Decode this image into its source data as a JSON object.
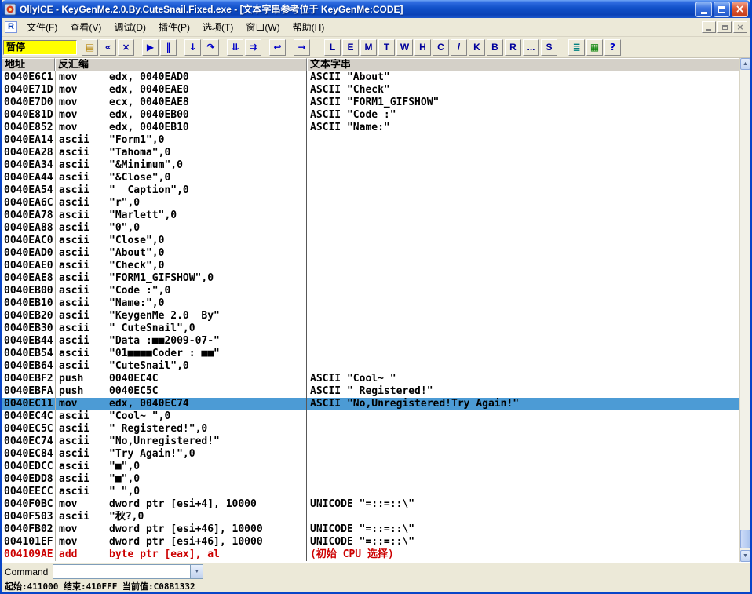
{
  "window": {
    "title": "OllyICE - KeyGenMe.2.0.By.CuteSnail.Fixed.exe - [文本字串参考位于 KeyGenMe:CODE]"
  },
  "mdi": {
    "icon_letter": "R"
  },
  "menu": {
    "items": [
      {
        "label": "文件(F)",
        "name": "menu-file"
      },
      {
        "label": "查看(V)",
        "name": "menu-view"
      },
      {
        "label": "调试(D)",
        "name": "menu-debug"
      },
      {
        "label": "插件(P)",
        "name": "menu-plugins"
      },
      {
        "label": "选项(T)",
        "name": "menu-options"
      },
      {
        "label": "窗口(W)",
        "name": "menu-window"
      },
      {
        "label": "帮助(H)",
        "name": "menu-help"
      }
    ]
  },
  "toolbar": {
    "status": "暂停",
    "buttons": [
      {
        "name": "open-button",
        "glyph": "▤",
        "color": "#B8860B"
      },
      {
        "name": "restart-button",
        "glyph": "«",
        "color": "#0000A8"
      },
      {
        "name": "close-program-button",
        "glyph": "×",
        "color": "#0000A8"
      },
      {
        "sep": true
      },
      {
        "name": "run-button",
        "glyph": "▶",
        "color": "#0000C8"
      },
      {
        "name": "pause-button",
        "glyph": "‖",
        "color": "#0000C8"
      },
      {
        "sep": true
      },
      {
        "name": "step-into-button",
        "glyph": "↓",
        "color": "#0000C8"
      },
      {
        "name": "step-over-button",
        "glyph": "↷",
        "color": "#0000C8"
      },
      {
        "sep": true
      },
      {
        "name": "trace-into-button",
        "glyph": "⇊",
        "color": "#0000C8"
      },
      {
        "name": "trace-over-button",
        "glyph": "⇉",
        "color": "#0000C8"
      },
      {
        "sep": true
      },
      {
        "name": "execute-till-return-button",
        "glyph": "↩",
        "color": "#0000C8"
      },
      {
        "sep": true
      },
      {
        "name": "goto-address-button",
        "glyph": "→",
        "color": "#0000C8"
      }
    ],
    "letters": [
      {
        "label": "L",
        "name": "log-window-button"
      },
      {
        "label": "E",
        "name": "executables-button"
      },
      {
        "label": "M",
        "name": "memory-map-button"
      },
      {
        "label": "T",
        "name": "threads-button"
      },
      {
        "label": "W",
        "name": "windows-button"
      },
      {
        "label": "H",
        "name": "handles-button"
      },
      {
        "label": "C",
        "name": "cpu-button"
      },
      {
        "label": "/",
        "name": "patches-button"
      },
      {
        "label": "K",
        "name": "call-stack-button"
      },
      {
        "label": "B",
        "name": "breakpoints-button"
      },
      {
        "label": "R",
        "name": "references-button"
      },
      {
        "label": "...",
        "name": "run-trace-button"
      },
      {
        "label": "S",
        "name": "source-button"
      }
    ],
    "right_buttons": [
      {
        "label": "≣",
        "name": "options-button",
        "color": "#008080"
      },
      {
        "label": "▦",
        "name": "appearance-button",
        "color": "#008000"
      },
      {
        "label": "?",
        "name": "help-button",
        "color": "#0000C8"
      }
    ]
  },
  "panel": {
    "headers": {
      "address": "地址",
      "disasm": "反汇编",
      "text": "文本字串"
    }
  },
  "rows": [
    {
      "addr": "0040E6C1",
      "mn": "mov",
      "ops": "edx, 0040EAD0",
      "cmt": "ASCII \"About\""
    },
    {
      "addr": "0040E71D",
      "mn": "mov",
      "ops": "edx, 0040EAE0",
      "cmt": "ASCII \"Check\""
    },
    {
      "addr": "0040E7D0",
      "mn": "mov",
      "ops": "ecx, 0040EAE8",
      "cmt": "ASCII \"FORM1_GIFSHOW\""
    },
    {
      "addr": "0040E81D",
      "mn": "mov",
      "ops": "edx, 0040EB00",
      "cmt": "ASCII \"Code :\""
    },
    {
      "addr": "0040E852",
      "mn": "mov",
      "ops": "edx, 0040EB10",
      "cmt": "ASCII \"Name:\""
    },
    {
      "addr": "0040EA14",
      "mn": "ascii",
      "ops": "\"Form1\",0",
      "cmt": ""
    },
    {
      "addr": "0040EA28",
      "mn": "ascii",
      "ops": "\"Tahoma\",0",
      "cmt": ""
    },
    {
      "addr": "0040EA34",
      "mn": "ascii",
      "ops": "\"&Minimum\",0",
      "cmt": ""
    },
    {
      "addr": "0040EA44",
      "mn": "ascii",
      "ops": "\"&Close\",0",
      "cmt": ""
    },
    {
      "addr": "0040EA54",
      "mn": "ascii",
      "ops": "\"  Caption\",0",
      "cmt": ""
    },
    {
      "addr": "0040EA6C",
      "mn": "ascii",
      "ops": "\"r\",0",
      "cmt": ""
    },
    {
      "addr": "0040EA78",
      "mn": "ascii",
      "ops": "\"Marlett\",0",
      "cmt": ""
    },
    {
      "addr": "0040EA88",
      "mn": "ascii",
      "ops": "\"0\",0",
      "cmt": ""
    },
    {
      "addr": "0040EAC0",
      "mn": "ascii",
      "ops": "\"Close\",0",
      "cmt": ""
    },
    {
      "addr": "0040EAD0",
      "mn": "ascii",
      "ops": "\"About\",0",
      "cmt": ""
    },
    {
      "addr": "0040EAE0",
      "mn": "ascii",
      "ops": "\"Check\",0",
      "cmt": ""
    },
    {
      "addr": "0040EAE8",
      "mn": "ascii",
      "ops": "\"FORM1_GIFSHOW\",0",
      "cmt": ""
    },
    {
      "addr": "0040EB00",
      "mn": "ascii",
      "ops": "\"Code :\",0",
      "cmt": ""
    },
    {
      "addr": "0040EB10",
      "mn": "ascii",
      "ops": "\"Name:\",0",
      "cmt": ""
    },
    {
      "addr": "0040EB20",
      "mn": "ascii",
      "ops": "\"KeygenMe 2.0  By\"",
      "cmt": ""
    },
    {
      "addr": "0040EB30",
      "mn": "ascii",
      "ops": "\" CuteSnail\",0",
      "cmt": ""
    },
    {
      "addr": "0040EB44",
      "mn": "ascii",
      "ops": "\"Data :■■2009-07-\"",
      "cmt": ""
    },
    {
      "addr": "0040EB54",
      "mn": "ascii",
      "ops": "\"01■■■■Coder : ■■\"",
      "cmt": ""
    },
    {
      "addr": "0040EB64",
      "mn": "ascii",
      "ops": "\"CuteSnail\",0",
      "cmt": ""
    },
    {
      "addr": "0040EBF2",
      "mn": "push",
      "ops": "0040EC4C",
      "cmt": "ASCII \"Cool~ \""
    },
    {
      "addr": "0040EBFA",
      "mn": "push",
      "ops": "0040EC5C",
      "cmt": "ASCII \" Registered!\""
    },
    {
      "addr": "0040EC11",
      "mn": "mov",
      "ops": "edx, 0040EC74",
      "cmt": "ASCII \"No,Unregistered!Try Again!\"",
      "state": "selected"
    },
    {
      "addr": "0040EC4C",
      "mn": "ascii",
      "ops": "\"Cool~ \",0",
      "cmt": ""
    },
    {
      "addr": "0040EC5C",
      "mn": "ascii",
      "ops": "\" Registered!\",0",
      "cmt": ""
    },
    {
      "addr": "0040EC74",
      "mn": "ascii",
      "ops": "\"No,Unregistered!\"",
      "cmt": ""
    },
    {
      "addr": "0040EC84",
      "mn": "ascii",
      "ops": "\"Try Again!\",0",
      "cmt": ""
    },
    {
      "addr": "0040EDCC",
      "mn": "ascii",
      "ops": "\"■\",0",
      "cmt": ""
    },
    {
      "addr": "0040EDD8",
      "mn": "ascii",
      "ops": "\"■\",0",
      "cmt": ""
    },
    {
      "addr": "0040EECC",
      "mn": "ascii",
      "ops": "\" \",0",
      "cmt": ""
    },
    {
      "addr": "0040F0BC",
      "mn": "mov",
      "ops": "dword ptr [esi+4], 10000",
      "cmt": "UNICODE \"=::=::\\\""
    },
    {
      "addr": "0040F503",
      "mn": "ascii",
      "ops": "\"秋?,0",
      "cmt": ""
    },
    {
      "addr": "0040FB02",
      "mn": "mov",
      "ops": "dword ptr [esi+46], 10000",
      "cmt": "UNICODE \"=::=::\\\""
    },
    {
      "addr": "004101EF",
      "mn": "mov",
      "ops": "dword ptr [esi+46], 10000",
      "cmt": "UNICODE \"=::=::\\\""
    },
    {
      "addr": "004109AE",
      "mn": "add",
      "ops": "byte ptr [eax], al",
      "cmt": "(初始 CPU 选择)",
      "state": "alert"
    }
  ],
  "command": {
    "label": "Command",
    "value": ""
  },
  "statusbar": {
    "text": "起始:411000 结束:410FFF 当前值:C08B1332"
  },
  "colors": {
    "selection": "#4C9BD5",
    "alert_text": "#CC0000",
    "paused_bg": "#FFFF00",
    "titlebar_blue": "#1150C8"
  }
}
